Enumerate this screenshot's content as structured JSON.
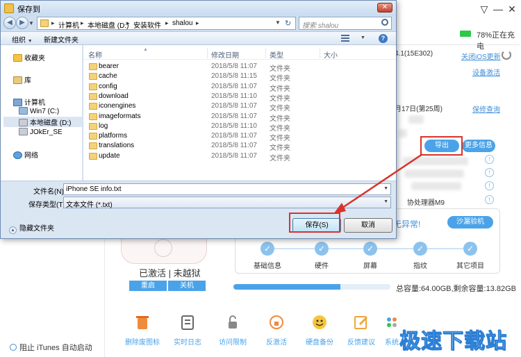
{
  "app": {
    "battery_text": "78%正在充电",
    "version_text": "4.1(15E302)",
    "close_ios_update_link": "关闭iOS更新",
    "activate_device_link": "设备激活",
    "date_text": "月17日(第25周)",
    "warranty_link": "保修查询",
    "export_button": "导出",
    "more_info_button": "更多信息",
    "coprocessor_text": "协处理器M9",
    "normal_text": "无异常!",
    "sandbox_button": "沙漏验机",
    "checks": [
      "基础信息",
      "硬件",
      "屏幕",
      "指纹",
      "其它项目"
    ],
    "phone_status": "已激活 | 未越狱",
    "restart_button": "重启",
    "shutdown_button": "关机",
    "capacity_fraction": 0.68,
    "capacity_text": "总容量:64.00GB,剩余容量:13.82GB",
    "tools": [
      "删除废图标",
      "实时日志",
      "访问限制",
      "反激活",
      "硬盘备份",
      "反馈建议",
      "系统"
    ],
    "itunes_label": "阻止 iTunes 自动启动",
    "watermark": "极速下载站"
  },
  "dialog": {
    "title": "保存到",
    "breadcrumb": [
      "计算机",
      "本地磁盘 (D:)",
      "安装软件",
      "shalou"
    ],
    "search_placeholder": "搜索 shalou",
    "organize_label": "组织",
    "new_folder_label": "新建文件夹",
    "nav": {
      "favorites": "收藏夹",
      "libraries": "库",
      "computer": "计算机",
      "drives": [
        "Win7 (C:)",
        "本地磁盘 (D:)",
        "JOkEr_SE"
      ],
      "network": "网络"
    },
    "columns": {
      "name": "名称",
      "date": "修改日期",
      "type": "类型",
      "size": "大小"
    },
    "files": [
      {
        "name": "bearer",
        "date": "2018/5/8 11:07",
        "type": "文件夹"
      },
      {
        "name": "cache",
        "date": "2018/5/8 11:15",
        "type": "文件夹"
      },
      {
        "name": "config",
        "date": "2018/5/8 11:07",
        "type": "文件夹"
      },
      {
        "name": "download",
        "date": "2018/5/8 11:10",
        "type": "文件夹"
      },
      {
        "name": "iconengines",
        "date": "2018/5/8 11:07",
        "type": "文件夹"
      },
      {
        "name": "imageformats",
        "date": "2018/5/8 11:07",
        "type": "文件夹"
      },
      {
        "name": "log",
        "date": "2018/5/8 11:10",
        "type": "文件夹"
      },
      {
        "name": "platforms",
        "date": "2018/5/8 11:07",
        "type": "文件夹"
      },
      {
        "name": "translations",
        "date": "2018/5/8 11:07",
        "type": "文件夹"
      },
      {
        "name": "update",
        "date": "2018/5/8 11:07",
        "type": "文件夹"
      }
    ],
    "filename_label": "文件名(N):",
    "filename_value": "iPhone SE info.txt",
    "filetype_label": "保存类型(T):",
    "filetype_value": "文本文件 (*.txt)",
    "hide_folders_label": "隐藏文件夹",
    "save_button": "保存(S)",
    "cancel_button": "取消"
  },
  "colors": {
    "accent": "#4aa3e8",
    "highlight": "#d9322a"
  }
}
